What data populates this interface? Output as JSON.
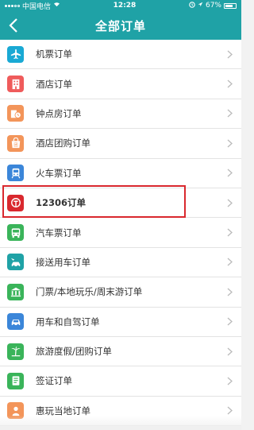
{
  "status_bar": {
    "carrier": "中国电信",
    "time": "12:28",
    "battery": "67%",
    "battery_level": 0.67
  },
  "header": {
    "title": "全部订单",
    "back_icon": "chevron-left-icon"
  },
  "orders": [
    {
      "label": "机票订单",
      "icon": "airplane-icon",
      "color": "#19a9d4"
    },
    {
      "label": "酒店订单",
      "icon": "hotel-building-icon",
      "color": "#ef5b5b"
    },
    {
      "label": "钟点房订单",
      "icon": "clock-hotel-icon",
      "color": "#f3955a"
    },
    {
      "label": "酒店团购订单",
      "icon": "group-buy-bag-icon",
      "color": "#f3955a"
    },
    {
      "label": "火车票订单",
      "icon": "train-icon",
      "color": "#3b86d9"
    },
    {
      "label": "12306订单",
      "icon": "railway-logo-icon",
      "color": "#d9282e"
    },
    {
      "label": "汽车票订单",
      "icon": "bus-icon",
      "color": "#3ab45a"
    },
    {
      "label": "接送用车订单",
      "icon": "pickup-car-icon",
      "color": "#1fa2a6"
    },
    {
      "label": "门票/本地玩乐/周末游订单",
      "icon": "ticket-building-icon",
      "color": "#3ab45a"
    },
    {
      "label": "用车和自驾订单",
      "icon": "car-icon",
      "color": "#3b86d9"
    },
    {
      "label": "旅游度假/团购订单",
      "icon": "palm-tree-icon",
      "color": "#3ab45a"
    },
    {
      "label": "签证订单",
      "icon": "visa-icon",
      "color": "#3ab45a"
    },
    {
      "label": "惠玩当地订单",
      "icon": "local-fun-icon",
      "color": "#f3955a"
    }
  ],
  "highlight_color": "#d9282e",
  "accent_color": "#1fa2a6"
}
